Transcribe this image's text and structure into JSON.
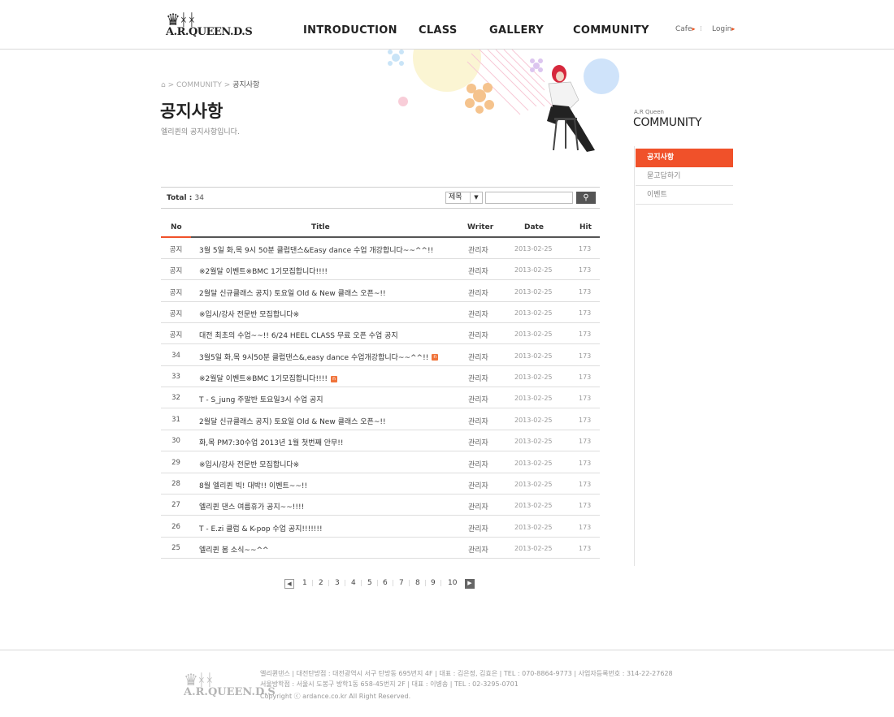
{
  "header": {
    "logo_text": "A.R.QUEEN.D.S",
    "nav": [
      "INTRODUCTION",
      "CLASS",
      "GALLERY",
      "COMMUNITY"
    ],
    "util_links": [
      "Cafe",
      "Login"
    ]
  },
  "breadcrumb": {
    "section": "COMMUNITY",
    "current": "공지사항"
  },
  "page": {
    "title": "공지사항",
    "description": "엘리퀸의 공지사항입니다."
  },
  "sidebar": {
    "subtitle": "A.R Queen",
    "title": "COMMUNITY",
    "items": [
      "공지사항",
      "묻고답하기",
      "이벤트"
    ]
  },
  "board": {
    "total_label": "Total :",
    "total_count": "34",
    "search_select": "제목",
    "search_value": "",
    "columns": [
      "No",
      "Title",
      "Writer",
      "Date",
      "Hit"
    ],
    "rows": [
      {
        "no": "공지",
        "title": "3월 5일 화,목 9시 50분 클럽댄스&Easy dance 수업 개강합니다~~^^!!",
        "new": false,
        "writer": "관리자",
        "date": "2013-02-25",
        "hit": "173"
      },
      {
        "no": "공지",
        "title": "※2월달 이벤트※BMC 1기모집합니다!!!!",
        "new": false,
        "writer": "관리자",
        "date": "2013-02-25",
        "hit": "173"
      },
      {
        "no": "공지",
        "title": "2월달 신규클래스 공지) 토요일 Old & New 클래스 오픈~!!",
        "new": false,
        "writer": "관리자",
        "date": "2013-02-25",
        "hit": "173"
      },
      {
        "no": "공지",
        "title": "※입시/강사 전문반 모집합니다※",
        "new": false,
        "writer": "관리자",
        "date": "2013-02-25",
        "hit": "173"
      },
      {
        "no": "공지",
        "title": "대전 최초의 수업~~!! 6/24 HEEL CLASS 무료 오픈 수업 공지",
        "new": false,
        "writer": "관리자",
        "date": "2013-02-25",
        "hit": "173"
      },
      {
        "no": "34",
        "title": "3월5일 화,목 9시50분 클럽댄스&,easy dance 수업개강합니다~~^^!!",
        "new": true,
        "writer": "관리자",
        "date": "2013-02-25",
        "hit": "173"
      },
      {
        "no": "33",
        "title": "※2월달 이벤트※BMC 1기모집합니다!!!!",
        "new": true,
        "writer": "관리자",
        "date": "2013-02-25",
        "hit": "173"
      },
      {
        "no": "32",
        "title": "T - S_jung 주말반 토요일3시 수업 공지",
        "new": false,
        "writer": "관리자",
        "date": "2013-02-25",
        "hit": "173"
      },
      {
        "no": "31",
        "title": "2월달 신규클래스 공지) 토요일 Old & New 클래스 오픈~!!",
        "new": false,
        "writer": "관리자",
        "date": "2013-02-25",
        "hit": "173"
      },
      {
        "no": "30",
        "title": "화,목 PM7:30수업 2013년 1월 첫번째 안무!!",
        "new": false,
        "writer": "관리자",
        "date": "2013-02-25",
        "hit": "173"
      },
      {
        "no": "29",
        "title": "※입시/강사 전문반 모집합니다※",
        "new": false,
        "writer": "관리자",
        "date": "2013-02-25",
        "hit": "173"
      },
      {
        "no": "28",
        "title": "8월 엘리퀸 빅! 대박!! 이벤트~~!!",
        "new": false,
        "writer": "관리자",
        "date": "2013-02-25",
        "hit": "173"
      },
      {
        "no": "27",
        "title": "엘리퀸 댄스 여름휴가 공지~~!!!!",
        "new": false,
        "writer": "관리자",
        "date": "2013-02-25",
        "hit": "173"
      },
      {
        "no": "26",
        "title": "T - E.zi 클럽 & K-pop 수업 공지!!!!!!!",
        "new": false,
        "writer": "관리자",
        "date": "2013-02-25",
        "hit": "173"
      },
      {
        "no": "25",
        "title": "엘리퀸 봄 소식~~^^",
        "new": false,
        "writer": "관리자",
        "date": "2013-02-25",
        "hit": "173"
      }
    ],
    "new_badge": "n"
  },
  "pagination": {
    "pages": [
      "1",
      "2",
      "3",
      "4",
      "5",
      "6",
      "7",
      "8",
      "9",
      "10"
    ]
  },
  "footer": {
    "line1": "엘리퀸댄스  |  대전탄방점 : 대전광역시 서구 탄방동 695번지 4F  |  대표 : 김은정, 김효은  |  TEL : 070-8864-9773  |  사업자등록번호 : 314-22-27628",
    "line2": "서울방학점 : 서울시 도봉구 방학1동 658-45번지 2F  |  대표 : 이병송  |  TEL : 02-3295-0701",
    "line3": "Copyright ⓒ ardance.co.kr  All Right Reserved."
  },
  "colors": {
    "accent": "#f0512a",
    "new_badge": "#f0733a"
  }
}
